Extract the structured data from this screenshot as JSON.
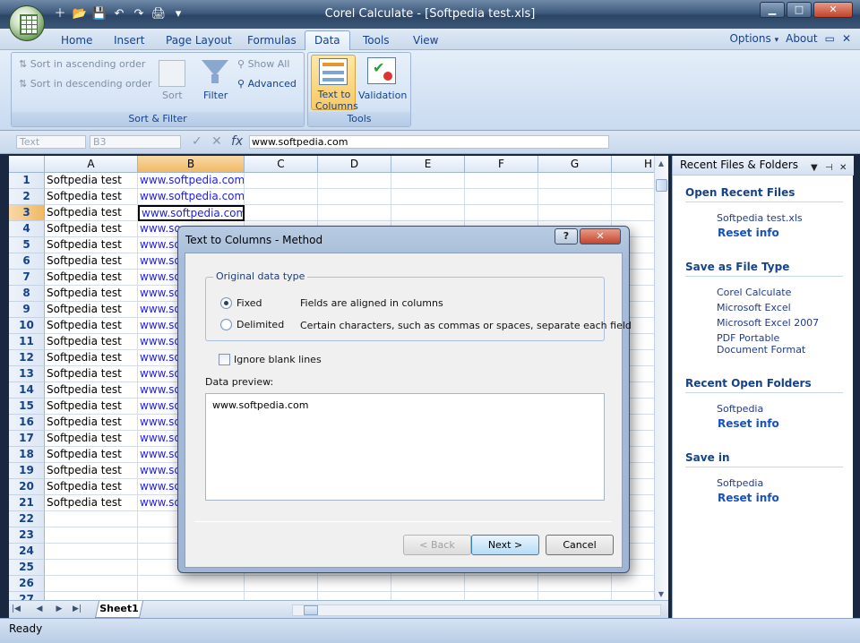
{
  "window": {
    "title": "Corel Calculate - [Softpedia test.xls]",
    "minimize": "▁",
    "maximize": "□",
    "close": "✕"
  },
  "qat": [
    "＋",
    "📂",
    "💾",
    "↶",
    "↷",
    "🖨",
    "▾"
  ],
  "ribbon": {
    "tabs": [
      "Home",
      "Insert",
      "Page Layout",
      "Formulas",
      "Data",
      "Tools",
      "View"
    ],
    "active_tab": "Data",
    "options": "Options",
    "options_caret": "▾",
    "about": "About",
    "doc_restore": "▭",
    "doc_close": "✕",
    "sort_filter": {
      "label": "Sort & Filter",
      "sort_asc": "Sort in ascending order",
      "sort_desc": "Sort in descending order",
      "sort": "Sort",
      "filter": "Filter",
      "show_all": "Show All",
      "advanced": "Advanced"
    },
    "tools": {
      "label": "Tools",
      "text_to_columns_1": "Text to",
      "text_to_columns_2": "Columns",
      "validation": "Validation"
    }
  },
  "formula_bar": {
    "style_box": "Text",
    "name_box": "B3",
    "accept": "✓",
    "cancel": "✕",
    "fx": "fx",
    "value": "www.softpedia.com"
  },
  "sheet": {
    "columns": [
      "A",
      "B",
      "C",
      "D",
      "E",
      "F",
      "G",
      "H"
    ],
    "selected_col": "B",
    "rows": [
      "1",
      "2",
      "3",
      "4",
      "5",
      "6",
      "7",
      "8",
      "9",
      "10",
      "11",
      "12",
      "13",
      "14",
      "15",
      "16",
      "17",
      "18",
      "19",
      "20",
      "21",
      "22",
      "23",
      "24",
      "25",
      "26",
      "27"
    ],
    "selected_row": "3",
    "col_a_values": [
      "Softpedia test",
      "Softpedia test",
      "Softpedia test",
      "Softpedia test",
      "Softpedia test",
      "Softpedia test",
      "Softpedia test",
      "Softpedia test",
      "Softpedia test",
      "Softpedia test",
      "Softpedia test",
      "Softpedia test",
      "Softpedia test",
      "Softpedia test",
      "Softpedia test",
      "Softpedia test",
      "Softpedia test",
      "Softpedia test",
      "Softpedia test",
      "Softpedia test",
      "Softpedia test"
    ],
    "col_b_full": [
      "www.softpedia.com",
      "www.softpedia.com",
      "www.softpedia.com"
    ],
    "col_b_clipped": "www.so",
    "tab_name": "Sheet1"
  },
  "panel": {
    "title": "Recent Files & Folders",
    "sections": [
      {
        "title": "Open Recent Files",
        "links": [
          "Softpedia test.xls"
        ],
        "reset": "Reset info"
      },
      {
        "title": "Save as File Type",
        "links": [
          "Corel Calculate",
          "Microsoft Excel",
          "Microsoft Excel 2007",
          "PDF Portable Document Format"
        ]
      },
      {
        "title": "Recent Open Folders",
        "links": [
          "Softpedia"
        ],
        "reset": "Reset info"
      },
      {
        "title": "Save in",
        "links": [
          "Softpedia"
        ],
        "reset": "Reset info"
      }
    ]
  },
  "dialog": {
    "title": "Text to Columns - Method",
    "help": "?",
    "close": "✕",
    "group_label": "Original data type",
    "fixed": "Fixed",
    "fixed_desc": "Fields are aligned in columns",
    "delimited": "Delimited",
    "delimited_desc": "Certain characters, such as commas or spaces, separate each field",
    "ignore_blank": "Ignore blank lines",
    "preview_label": "Data preview:",
    "preview_text": "www.softpedia.com",
    "back": "< Back",
    "next": "Next >",
    "cancel": "Cancel",
    "selected_type": "Fixed"
  },
  "status": {
    "text": "Ready"
  },
  "colors": {
    "accent": "#15428b",
    "link": "#1a1aff",
    "selection": "#f1b962"
  }
}
